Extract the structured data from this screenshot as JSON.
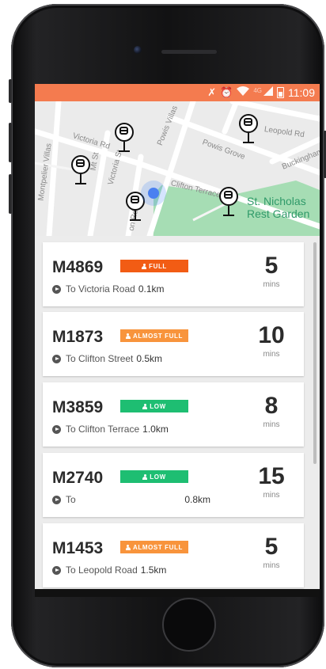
{
  "status_bar": {
    "time": "11:09",
    "network_label": "4G",
    "icons": [
      "bluetooth-off-icon",
      "alarm-icon",
      "wifi-icon",
      "signal-icon",
      "battery-icon"
    ]
  },
  "map": {
    "streets": [
      "Victoria Rd",
      "Mt St",
      "Victoria St",
      "Powis Villas",
      "Powis Grove",
      "Leopold Rd",
      "Buckingham",
      "Clifton Terrace",
      "Montpelier Villas",
      "on Rd"
    ],
    "park_name_line1": "St. Nicholas",
    "park_name_line2": "Rest Garden"
  },
  "buses": [
    {
      "route": "M4869",
      "capacity": "FULL",
      "capacity_color": "#f25c14",
      "destination": "To Victoria Road",
      "distance": "0.1km",
      "eta": "5",
      "eta_unit": "mins"
    },
    {
      "route": "M1873",
      "capacity": "ALMOST FULL",
      "capacity_color": "#f8943c",
      "destination": "To Clifton Street",
      "distance": "0.5km",
      "eta": "10",
      "eta_unit": "mins"
    },
    {
      "route": "M3859",
      "capacity": "LOW",
      "capacity_color": "#1ebe72",
      "destination": "To Clifton Terrace",
      "distance": "1.0km",
      "eta": "8",
      "eta_unit": "mins"
    },
    {
      "route": "M2740",
      "capacity": "LOW",
      "capacity_color": "#1ebe72",
      "destination": "To",
      "distance": "0.8km",
      "eta": "15",
      "eta_unit": "mins"
    },
    {
      "route": "M1453",
      "capacity": "ALMOST FULL",
      "capacity_color": "#f8943c",
      "destination": "To Leopold Road",
      "distance": "1.5km",
      "eta": "5",
      "eta_unit": "mins"
    }
  ],
  "colors": {
    "accent": "#f47b4f",
    "park": "#a6ddb4",
    "user_location": "#4a80f0"
  }
}
